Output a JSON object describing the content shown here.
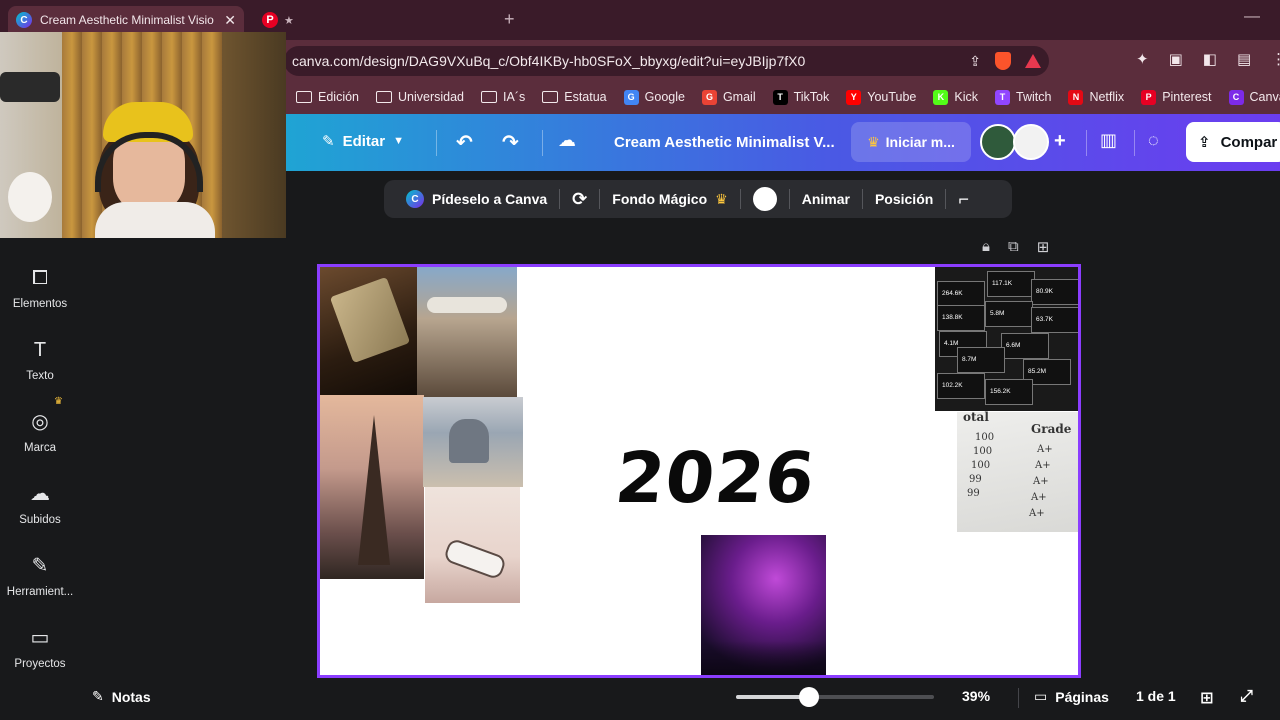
{
  "browser": {
    "active_tab_title": "Cream Aesthetic Minimalist Visio",
    "url": "canva.com/design/DAG9VXuBq_c/Obf4IKBy-hb0SFoX_bbyxg/edit?ui=eyJBIjp7fX0",
    "bookmarks": [
      {
        "label": "Edición",
        "icon": "folder-icon"
      },
      {
        "label": "Universidad",
        "icon": "folder-icon"
      },
      {
        "label": "IA´s",
        "icon": "folder-icon"
      },
      {
        "label": "Estatua",
        "icon": "folder-icon"
      },
      {
        "label": "Google",
        "icon": "google-icon"
      },
      {
        "label": "Gmail",
        "icon": "gmail-icon"
      },
      {
        "label": "TikTok",
        "icon": "tiktok-icon"
      },
      {
        "label": "YouTube",
        "icon": "youtube-icon"
      },
      {
        "label": "Kick",
        "icon": "kick-icon"
      },
      {
        "label": "Twitch",
        "icon": "twitch-icon"
      },
      {
        "label": "Netflix",
        "icon": "netflix-icon"
      },
      {
        "label": "Pinterest",
        "icon": "pinterest-icon"
      },
      {
        "label": "Canva",
        "icon": "canva-icon"
      }
    ]
  },
  "header": {
    "edit_label": "Editar",
    "design_title": "Cream Aesthetic Minimalist V...",
    "pro_label": "Iniciar m...",
    "share_label": "Compar"
  },
  "context_toolbar": {
    "ask_canva": "Pídeselo a Canva",
    "magic_bg": "Fondo Mágico",
    "animate": "Animar",
    "position": "Posición"
  },
  "sidebar": {
    "items": [
      {
        "label": "Elementos",
        "icon": "elements-icon"
      },
      {
        "label": "Texto",
        "icon": "text-icon"
      },
      {
        "label": "Marca",
        "icon": "brand-icon"
      },
      {
        "label": "Subidos",
        "icon": "upload-icon"
      },
      {
        "label": "Herramient...",
        "icon": "tools-icon"
      },
      {
        "label": "Proyectos",
        "icon": "projects-icon"
      }
    ]
  },
  "canvas": {
    "headline": "2026",
    "stats": [
      "264.6K",
      "117.1K",
      "80.9K",
      "138.8K",
      "5.8M",
      "63.7K",
      "4.1M",
      "6.6M",
      "8.7M",
      "85.2M",
      "102.2K",
      "156.2K"
    ],
    "grades": {
      "header_left": "otal",
      "header_right": "Grade",
      "rows": [
        {
          "score": "100",
          "grade": "A+"
        },
        {
          "score": "100",
          "grade": "A+"
        },
        {
          "score": "100",
          "grade": "A+"
        },
        {
          "score": "99",
          "grade": "A+"
        },
        {
          "score": "99",
          "grade": "A+"
        }
      ]
    }
  },
  "footer": {
    "notes_label": "Notas",
    "zoom": "39%",
    "pages_label": "Páginas",
    "page_count": "1 de 1",
    "zoom_fraction": 0.37
  },
  "colors": {
    "accent": "#8b3dff",
    "browser_frame": "#5b2d3c"
  }
}
